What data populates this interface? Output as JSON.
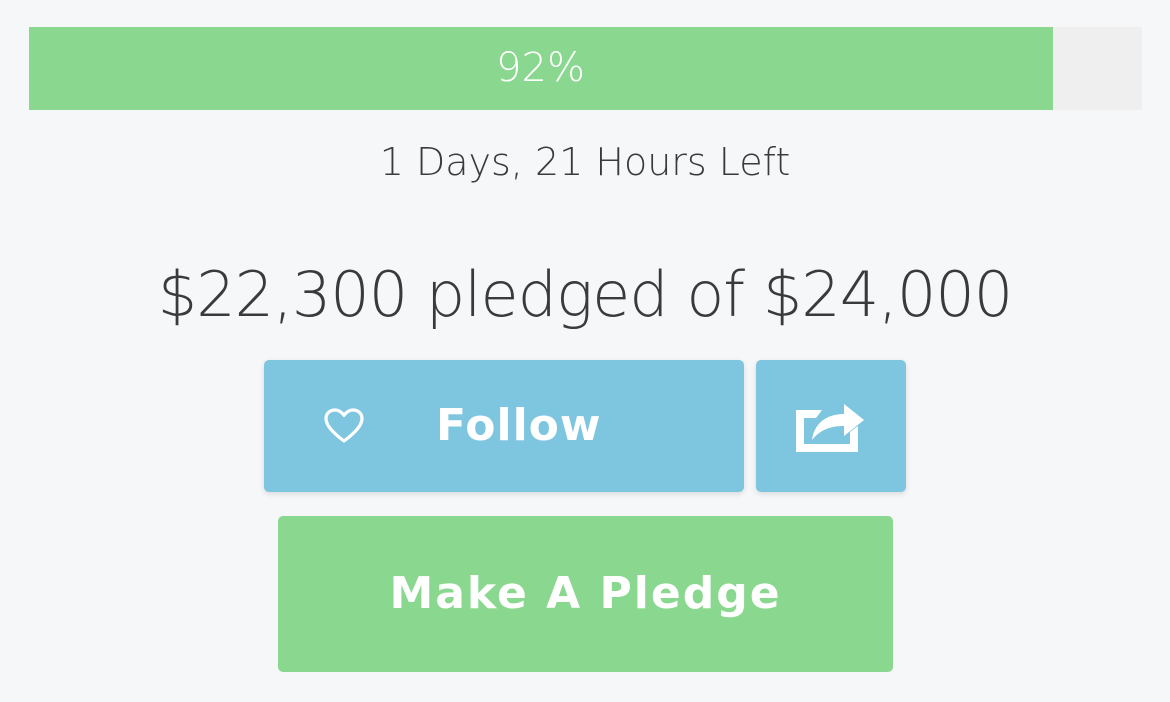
{
  "progress": {
    "percent_label": "92%",
    "fraction": 0.92,
    "fill_color": "#8ad88f",
    "track_color": "#efefef"
  },
  "time_left": "1 Days, 21 Hours Left",
  "pledged_summary": "$22,300 pledged of $24,000",
  "actions": {
    "follow_label": "Follow",
    "follow_icon": "heart-outline-icon",
    "share_icon": "share-icon",
    "pledge_label": "Make A Pledge",
    "blue_color": "#7ec6e0",
    "green_color": "#8ad88f"
  }
}
